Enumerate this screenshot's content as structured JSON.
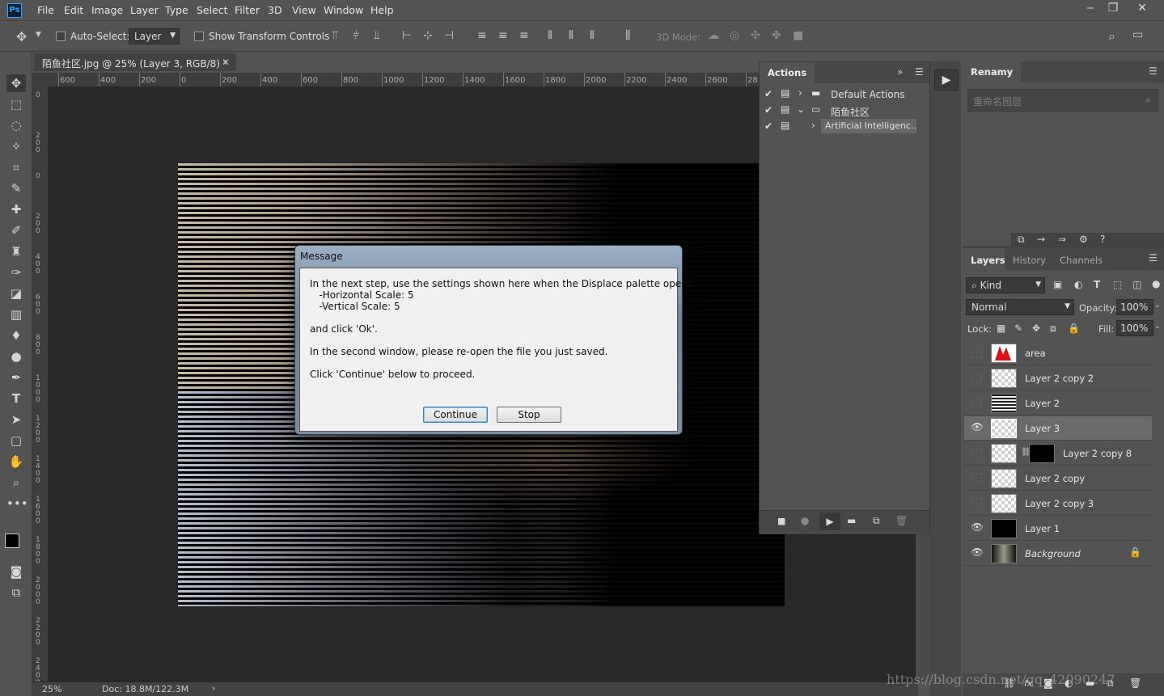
{
  "app": {
    "logo": "Ps",
    "menus": [
      "File",
      "Edit",
      "Image",
      "Layer",
      "Type",
      "Select",
      "Filter",
      "3D",
      "View",
      "Window",
      "Help"
    ]
  },
  "options": {
    "auto_select_label": "Auto-Select:",
    "auto_select_value": "Layer",
    "show_transform_label": "Show Transform Controls",
    "mode_3d_label": "3D Mode:"
  },
  "document": {
    "tab_title": "陌鱼社区.jpg @ 25% (Layer 3, RGB/8) *",
    "zoom": "25%",
    "doc_size": "Doc: 18.8M/122.3M"
  },
  "ruler": {
    "h_ticks": [
      "600",
      "400",
      "200",
      "0",
      "200",
      "400",
      "600",
      "800",
      "1000",
      "1200",
      "1400",
      "1600",
      "1800",
      "2000",
      "2200",
      "2400",
      "2600",
      "28"
    ],
    "v_ticks": [
      "0",
      "200",
      "0",
      "200",
      "400",
      "600",
      "800",
      "1000",
      "1200",
      "1400",
      "1600",
      "1800",
      "2000",
      "2200",
      "2400"
    ]
  },
  "actions": {
    "tab": "Actions",
    "items": [
      {
        "label": "Default Actions",
        "type": "set"
      },
      {
        "label": "陌鱼社区",
        "type": "set"
      },
      {
        "label": "Artificial Intelligenc...",
        "type": "action"
      }
    ]
  },
  "renamy": {
    "tab": "Renamy",
    "search_placeholder": "重命名图层"
  },
  "layers_panel": {
    "tabs": [
      "Layers",
      "History",
      "Channels"
    ],
    "kind_label": "Kind",
    "blend_mode": "Normal",
    "opacity_label": "Opacity:",
    "opacity_value": "100%",
    "lock_label": "Lock:",
    "fill_label": "Fill:",
    "fill_value": "100%",
    "layers": [
      {
        "name": "area",
        "visible": false
      },
      {
        "name": "Layer 2 copy 2",
        "visible": false
      },
      {
        "name": "Layer 2",
        "visible": false
      },
      {
        "name": "Layer 3",
        "visible": true,
        "selected": true
      },
      {
        "name": "Layer 2 copy 8",
        "visible": false
      },
      {
        "name": "Layer 2 copy",
        "visible": false
      },
      {
        "name": "Layer 2 copy 3",
        "visible": false
      },
      {
        "name": "Layer 1",
        "visible": true
      },
      {
        "name": "Background",
        "visible": true
      }
    ]
  },
  "dialog": {
    "title": "Message",
    "line1": "In the next step, use the settings shown here when the Displace palette opens.",
    "line2": "   -Horizontal Scale: 5",
    "line3": "   -Vertical Scale: 5",
    "line4": "and click 'Ok'.",
    "line5": "In the second window, please re-open the file you just saved.",
    "line6": "Click 'Continue' below to proceed.",
    "continue_label": "Continue",
    "stop_label": "Stop"
  },
  "watermark": "https://blog.csdn.net/qq_42090247"
}
